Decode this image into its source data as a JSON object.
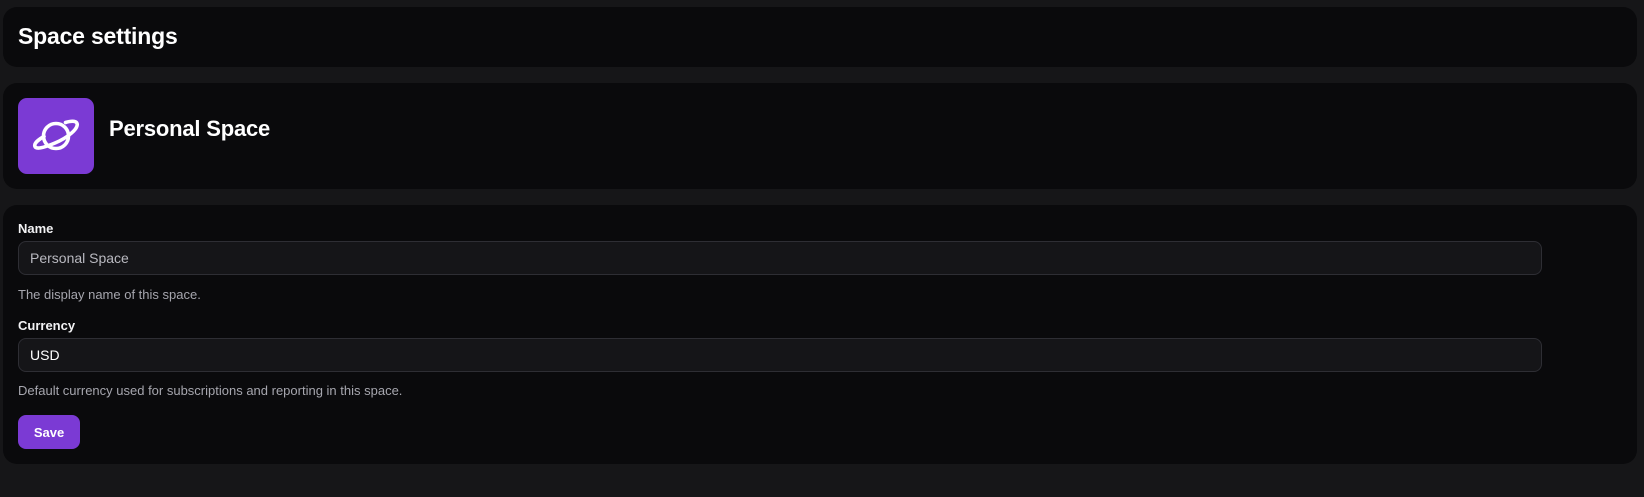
{
  "header": {
    "title": "Space settings"
  },
  "space": {
    "name": "Personal Space",
    "icon": "planet-icon",
    "accent_color": "#7b3ad4"
  },
  "form": {
    "name_field": {
      "label": "Name",
      "value": "Personal Space",
      "helper": "The display name of this space."
    },
    "currency_field": {
      "label": "Currency",
      "value": "USD",
      "helper": "Default currency used for subscriptions and reporting in this space."
    },
    "save_label": "Save"
  }
}
